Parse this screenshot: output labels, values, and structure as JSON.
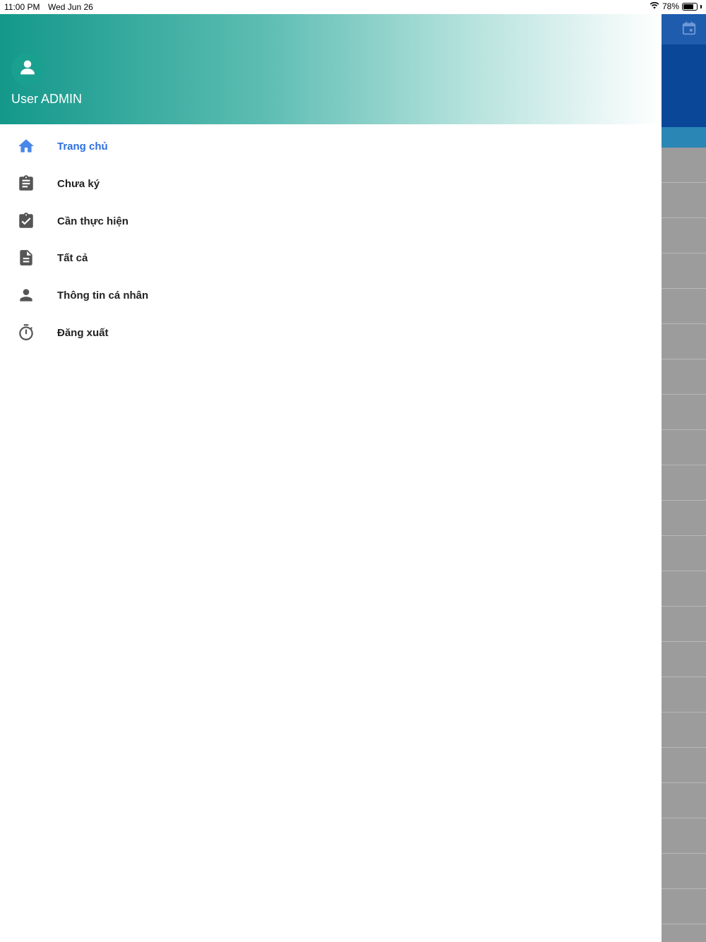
{
  "status_bar": {
    "time": "11:00 PM",
    "date": "Wed Jun 26",
    "battery": "78%",
    "battery_level": 0.78
  },
  "drawer": {
    "user_name": "User ADMIN",
    "avatar_icon": "person-icon",
    "menu": [
      {
        "label": "Trang chủ",
        "icon": "home-icon",
        "active": true
      },
      {
        "label": "Chưa ký",
        "icon": "clipboard-icon",
        "active": false
      },
      {
        "label": "Cần thực hiện",
        "icon": "clipboard-check-icon",
        "active": false
      },
      {
        "label": "Tất cả",
        "icon": "document-icon",
        "active": false
      },
      {
        "label": "Thông tin cá nhân",
        "icon": "person-icon",
        "active": false
      },
      {
        "label": "Đăng xuất",
        "icon": "timer-icon",
        "active": false
      }
    ]
  },
  "colors": {
    "header_gradient_start": "#13988a",
    "active": "#2d6fe0",
    "icon_gray": "#555555",
    "bg_topbar": "#1f5cae"
  }
}
